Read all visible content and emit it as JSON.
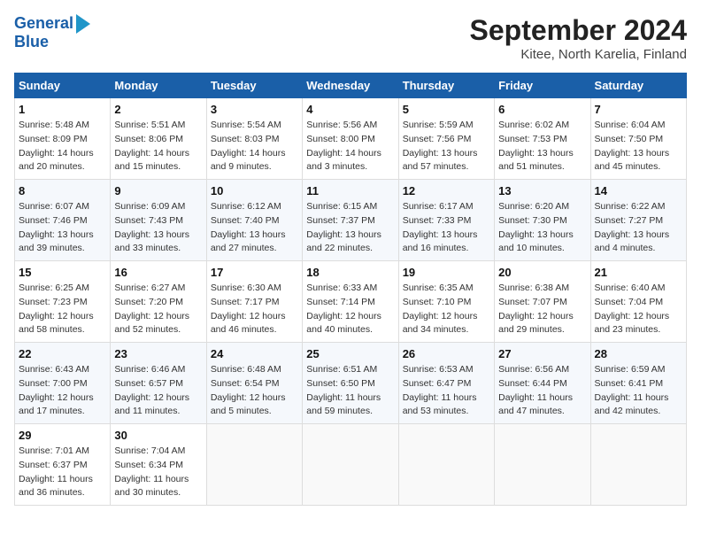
{
  "header": {
    "logo_line1": "General",
    "logo_line2": "Blue",
    "title": "September 2024",
    "subtitle": "Kitee, North Karelia, Finland"
  },
  "calendar": {
    "days_of_week": [
      "Sunday",
      "Monday",
      "Tuesday",
      "Wednesday",
      "Thursday",
      "Friday",
      "Saturday"
    ],
    "weeks": [
      [
        {
          "day": "1",
          "info": "Sunrise: 5:48 AM\nSunset: 8:09 PM\nDaylight: 14 hours\nand 20 minutes."
        },
        {
          "day": "2",
          "info": "Sunrise: 5:51 AM\nSunset: 8:06 PM\nDaylight: 14 hours\nand 15 minutes."
        },
        {
          "day": "3",
          "info": "Sunrise: 5:54 AM\nSunset: 8:03 PM\nDaylight: 14 hours\nand 9 minutes."
        },
        {
          "day": "4",
          "info": "Sunrise: 5:56 AM\nSunset: 8:00 PM\nDaylight: 14 hours\nand 3 minutes."
        },
        {
          "day": "5",
          "info": "Sunrise: 5:59 AM\nSunset: 7:56 PM\nDaylight: 13 hours\nand 57 minutes."
        },
        {
          "day": "6",
          "info": "Sunrise: 6:02 AM\nSunset: 7:53 PM\nDaylight: 13 hours\nand 51 minutes."
        },
        {
          "day": "7",
          "info": "Sunrise: 6:04 AM\nSunset: 7:50 PM\nDaylight: 13 hours\nand 45 minutes."
        }
      ],
      [
        {
          "day": "8",
          "info": "Sunrise: 6:07 AM\nSunset: 7:46 PM\nDaylight: 13 hours\nand 39 minutes."
        },
        {
          "day": "9",
          "info": "Sunrise: 6:09 AM\nSunset: 7:43 PM\nDaylight: 13 hours\nand 33 minutes."
        },
        {
          "day": "10",
          "info": "Sunrise: 6:12 AM\nSunset: 7:40 PM\nDaylight: 13 hours\nand 27 minutes."
        },
        {
          "day": "11",
          "info": "Sunrise: 6:15 AM\nSunset: 7:37 PM\nDaylight: 13 hours\nand 22 minutes."
        },
        {
          "day": "12",
          "info": "Sunrise: 6:17 AM\nSunset: 7:33 PM\nDaylight: 13 hours\nand 16 minutes."
        },
        {
          "day": "13",
          "info": "Sunrise: 6:20 AM\nSunset: 7:30 PM\nDaylight: 13 hours\nand 10 minutes."
        },
        {
          "day": "14",
          "info": "Sunrise: 6:22 AM\nSunset: 7:27 PM\nDaylight: 13 hours\nand 4 minutes."
        }
      ],
      [
        {
          "day": "15",
          "info": "Sunrise: 6:25 AM\nSunset: 7:23 PM\nDaylight: 12 hours\nand 58 minutes."
        },
        {
          "day": "16",
          "info": "Sunrise: 6:27 AM\nSunset: 7:20 PM\nDaylight: 12 hours\nand 52 minutes."
        },
        {
          "day": "17",
          "info": "Sunrise: 6:30 AM\nSunset: 7:17 PM\nDaylight: 12 hours\nand 46 minutes."
        },
        {
          "day": "18",
          "info": "Sunrise: 6:33 AM\nSunset: 7:14 PM\nDaylight: 12 hours\nand 40 minutes."
        },
        {
          "day": "19",
          "info": "Sunrise: 6:35 AM\nSunset: 7:10 PM\nDaylight: 12 hours\nand 34 minutes."
        },
        {
          "day": "20",
          "info": "Sunrise: 6:38 AM\nSunset: 7:07 PM\nDaylight: 12 hours\nand 29 minutes."
        },
        {
          "day": "21",
          "info": "Sunrise: 6:40 AM\nSunset: 7:04 PM\nDaylight: 12 hours\nand 23 minutes."
        }
      ],
      [
        {
          "day": "22",
          "info": "Sunrise: 6:43 AM\nSunset: 7:00 PM\nDaylight: 12 hours\nand 17 minutes."
        },
        {
          "day": "23",
          "info": "Sunrise: 6:46 AM\nSunset: 6:57 PM\nDaylight: 12 hours\nand 11 minutes."
        },
        {
          "day": "24",
          "info": "Sunrise: 6:48 AM\nSunset: 6:54 PM\nDaylight: 12 hours\nand 5 minutes."
        },
        {
          "day": "25",
          "info": "Sunrise: 6:51 AM\nSunset: 6:50 PM\nDaylight: 11 hours\nand 59 minutes."
        },
        {
          "day": "26",
          "info": "Sunrise: 6:53 AM\nSunset: 6:47 PM\nDaylight: 11 hours\nand 53 minutes."
        },
        {
          "day": "27",
          "info": "Sunrise: 6:56 AM\nSunset: 6:44 PM\nDaylight: 11 hours\nand 47 minutes."
        },
        {
          "day": "28",
          "info": "Sunrise: 6:59 AM\nSunset: 6:41 PM\nDaylight: 11 hours\nand 42 minutes."
        }
      ],
      [
        {
          "day": "29",
          "info": "Sunrise: 7:01 AM\nSunset: 6:37 PM\nDaylight: 11 hours\nand 36 minutes."
        },
        {
          "day": "30",
          "info": "Sunrise: 7:04 AM\nSunset: 6:34 PM\nDaylight: 11 hours\nand 30 minutes."
        },
        {
          "day": "",
          "info": ""
        },
        {
          "day": "",
          "info": ""
        },
        {
          "day": "",
          "info": ""
        },
        {
          "day": "",
          "info": ""
        },
        {
          "day": "",
          "info": ""
        }
      ]
    ]
  }
}
